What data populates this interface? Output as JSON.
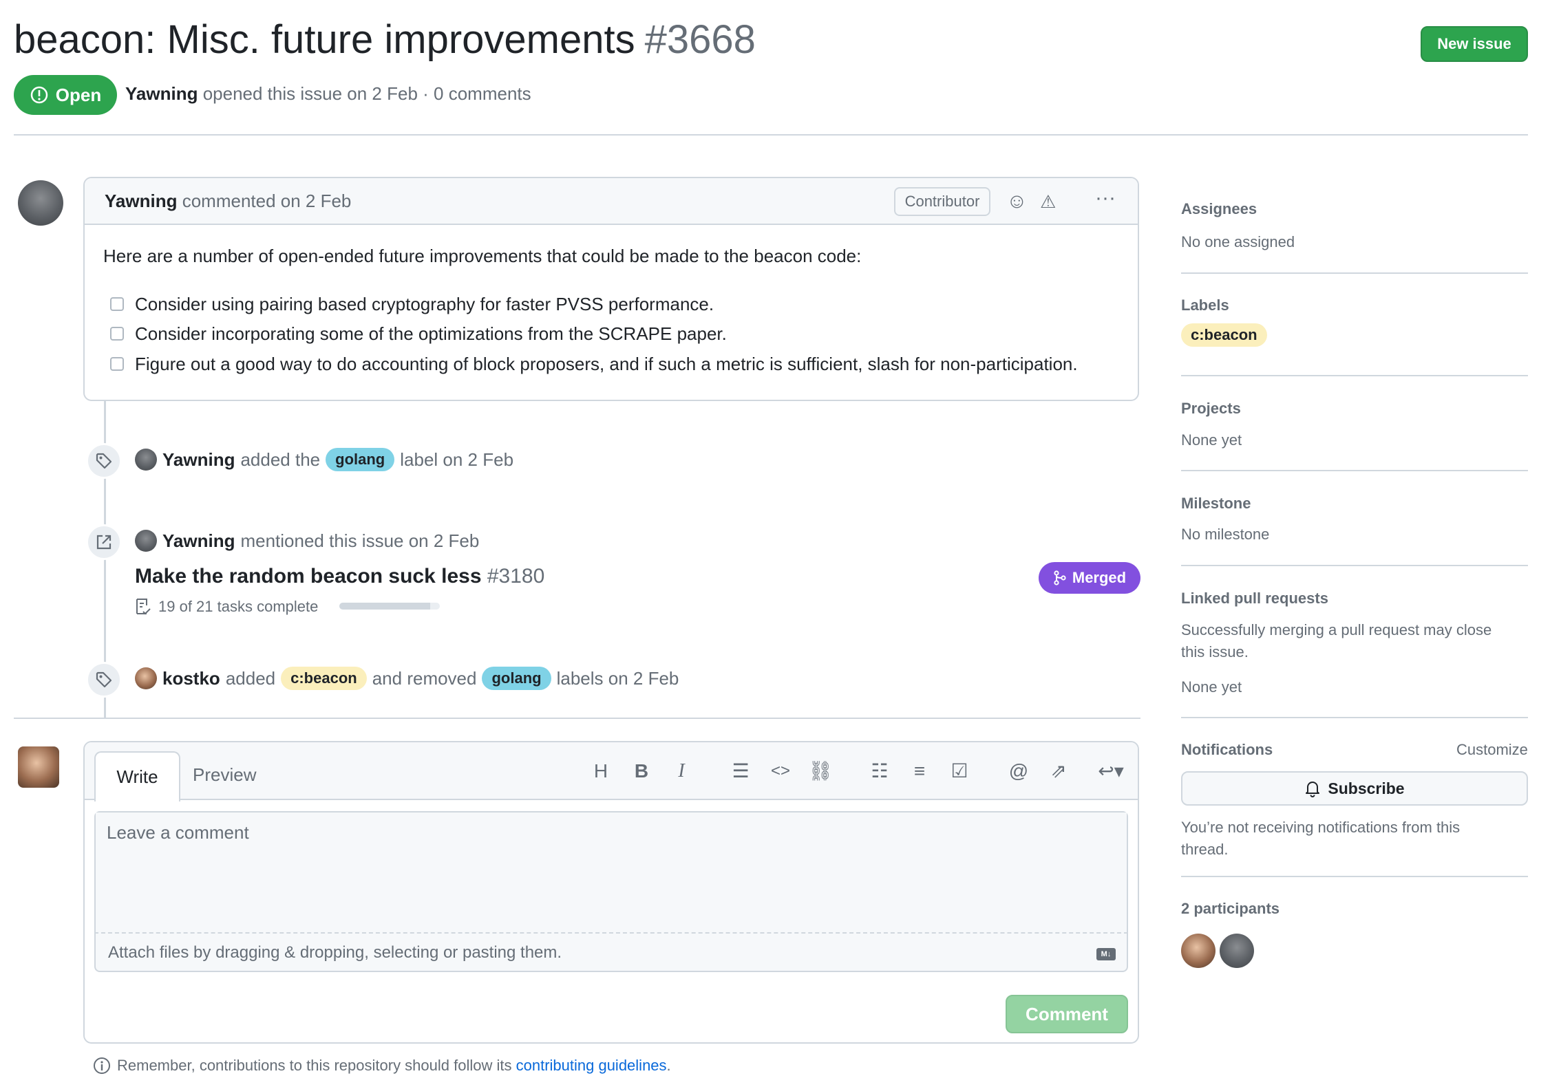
{
  "issue": {
    "title": "beacon: Misc. future improvements",
    "number": "#3668",
    "state": "Open",
    "author": "Yawning",
    "opened_text": "opened this issue on 2 Feb · 0 comments",
    "new_issue_label": "New issue"
  },
  "comment": {
    "author": "Yawning",
    "meta": "commented on 2 Feb",
    "role_badge": "Contributor",
    "body": "Here are a number of open-ended future improvements that could be made to the beacon code:",
    "tasks": [
      "Consider using pairing based cryptography for faster PVSS performance.",
      "Consider incorporating some of the optimizations from the SCRAPE paper.",
      "Figure out a good way to do accounting of block proposers, and if such a metric is sufficient, slash for non-participation."
    ]
  },
  "timeline": {
    "event1": {
      "actor": "Yawning",
      "pre": "added the",
      "label": "golang",
      "post": "label on 2 Feb"
    },
    "event2": {
      "actor": "Yawning",
      "text": "mentioned this issue on 2 Feb",
      "pr_title": "Make the random beacon suck less",
      "pr_number": "#3180",
      "pr_state": "Merged",
      "tasks_text": "19 of 21 tasks complete",
      "tasks_done": 19,
      "tasks_total": 21
    },
    "event3": {
      "actor": "kostko",
      "pre": "added",
      "added_label": "c:beacon",
      "mid": "and removed",
      "removed_label": "golang",
      "post": "labels on 2 Feb"
    }
  },
  "composer": {
    "tab_write": "Write",
    "tab_preview": "Preview",
    "placeholder": "Leave a comment",
    "attach_text": "Attach files by dragging & dropping, selecting or pasting them.",
    "md_badge": "M↓",
    "submit_label": "Comment",
    "remember_text": "Remember, contributions to this repository should follow its",
    "remember_link": "contributing guidelines",
    "remember_end": "."
  },
  "sidebar": {
    "assignees_head": "Assignees",
    "assignees_val": "No one assigned",
    "labels_head": "Labels",
    "labels_val": "c:beacon",
    "projects_head": "Projects",
    "projects_val": "None yet",
    "milestone_head": "Milestone",
    "milestone_val": "No milestone",
    "linked_head": "Linked pull requests",
    "linked_desc_1": "Successfully merging a pull request may close",
    "linked_desc_2": "this issue.",
    "linked_val": "None yet",
    "notifications_head": "Notifications",
    "customize": "Customize",
    "subscribe": "Subscribe",
    "notif_desc_1": "You’re not receiving notifications from this",
    "notif_desc_2": "thread.",
    "participants_head": "2 participants"
  },
  "colors": {
    "open_green": "#2da44e",
    "merged_purple": "#8250df",
    "golang_label": "#7fd2e6",
    "beacon_label": "#fbefbc",
    "link_blue": "#0969da"
  }
}
